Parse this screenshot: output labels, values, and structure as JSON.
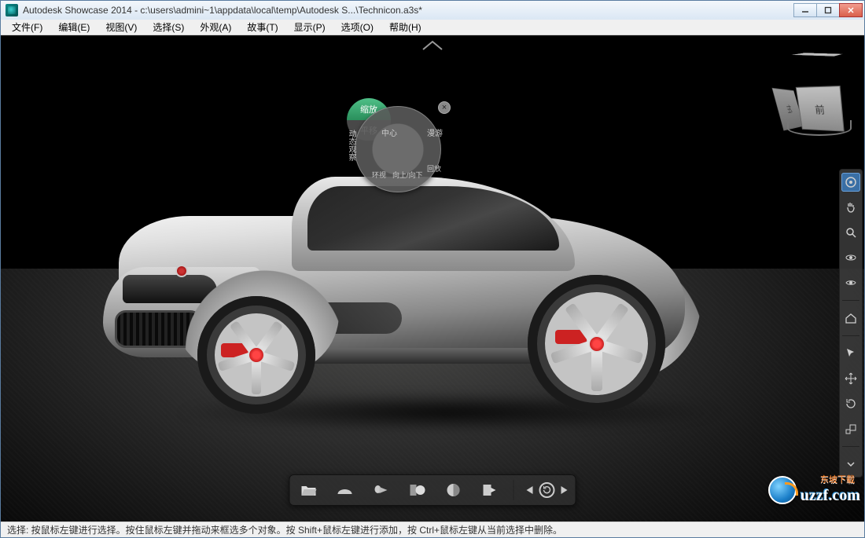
{
  "title": "Autodesk Showcase 2014 - c:\\users\\admini~1\\appdata\\local\\temp\\Autodesk S...\\Technicon.a3s*",
  "menu": {
    "file": "文件(F)",
    "edit": "编辑(E)",
    "view": "视图(V)",
    "select": "选择(S)",
    "look": "外观(A)",
    "story": "故事(T)",
    "display": "显示(P)",
    "options": "选项(O)",
    "help": "帮助(H)"
  },
  "navwheel": {
    "zoom": "缩放",
    "pan": "平移",
    "orbit": "动态观察",
    "center": "中心",
    "roam": "漫游",
    "look": "环视",
    "updown": "向上/向下",
    "rewind": "回放"
  },
  "viewcube": {
    "front": "前",
    "left": "左"
  },
  "status": "选择: 按鼠标左键进行选择。按住鼠标左键并拖动来框选多个对象。按 Shift+鼠标左键进行添加，按 Ctrl+鼠标左键从当前选择中删除。",
  "watermark": {
    "site": "uzzf.com",
    "cn": "东坡下载"
  },
  "colors": {
    "accent": "#4fbf87",
    "toolbar_active": "#3a6fa5"
  }
}
